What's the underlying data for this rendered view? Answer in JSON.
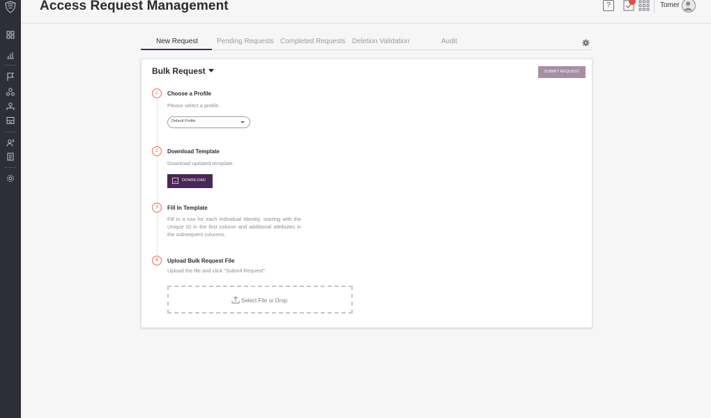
{
  "header": {
    "title": "Access Request Management",
    "help_label": "?",
    "user_name": "Tomer"
  },
  "tabs": [
    {
      "label": "New Request",
      "active": true
    },
    {
      "label": "Pending Requests",
      "active": false
    },
    {
      "label": "Completed Requests",
      "active": false
    },
    {
      "label": "Deletion Validation",
      "active": false
    },
    {
      "label": "Audit",
      "active": false
    }
  ],
  "card": {
    "title": "Bulk Request",
    "submit_label": "Submit Request"
  },
  "steps": [
    {
      "number": "1",
      "title": "Choose a Profile",
      "description": "Please select a profile."
    },
    {
      "number": "2",
      "title": "Download Template",
      "description": "Download updated template."
    },
    {
      "number": "3",
      "title": "Fill In Template",
      "description": "Fill in a row for each Individual Identity, starting with the Unique ID in the first column and additional attributes in the subsequent columns."
    },
    {
      "number": "4",
      "title": "Upload Bulk Request File",
      "description": "Upload the file and click \"Submit Request\"."
    }
  ],
  "profile_select": {
    "value": "Default Profile"
  },
  "download": {
    "label": "Download"
  },
  "upload": {
    "label": "Select File or Drop"
  },
  "colors": {
    "rail": "#2d2f38",
    "accent": "#4a2656",
    "submit_button": "#a58fa6",
    "step_circle": "#f06548",
    "badge": "#e84b4b"
  },
  "icons": {
    "rail": [
      "logo-shield",
      "dashboard-icon",
      "reports-icon",
      "flag-icon",
      "users-icon",
      "groups-icon",
      "inbox-icon",
      "access-icon",
      "document-icon",
      "settings-icon"
    ],
    "header": [
      "help-icon",
      "tasks-icon",
      "apps-grid-icon",
      "user-avatar-icon"
    ]
  }
}
